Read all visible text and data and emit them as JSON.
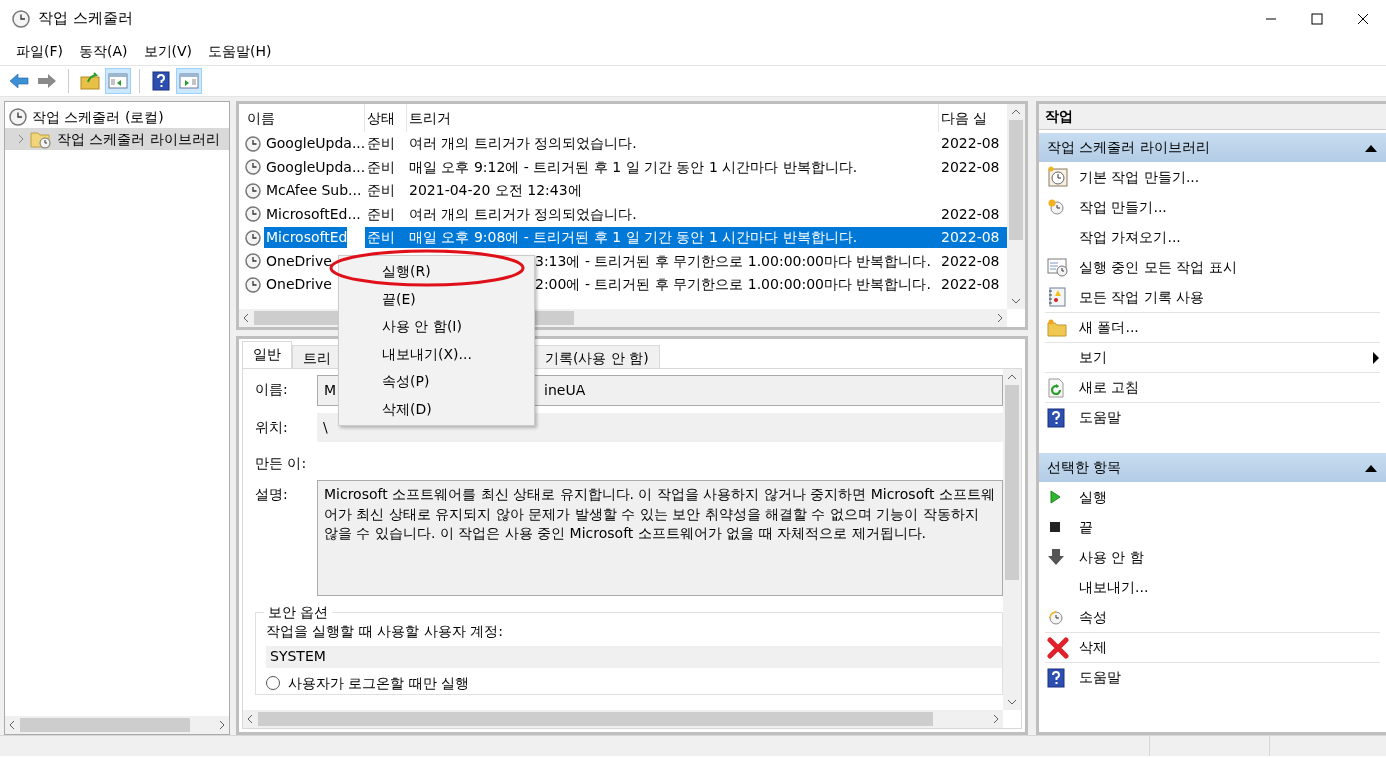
{
  "window": {
    "title": "작업 스케줄러"
  },
  "menu_bar": [
    "파일(F)",
    "동작(A)",
    "보기(V)",
    "도움말(H)"
  ],
  "toolbar": [
    {
      "pressed": false,
      "disabled": false
    },
    {
      "pressed": false,
      "disabled": true
    },
    {
      "pressed": false,
      "disabled": false
    },
    {
      "pressed": true,
      "disabled": false
    },
    {
      "pressed": false,
      "disabled": false
    },
    {
      "pressed": true,
      "disabled": false
    }
  ],
  "tree": [
    {
      "label": "작업 스케줄러 (로컬)",
      "selected": false,
      "children": [
        {
          "label": "작업 스케줄러 라이브러리",
          "selected": true,
          "expanded": false
        }
      ]
    }
  ],
  "table": {
    "columns": [
      "이름",
      "상태",
      "트리거",
      "다음 실"
    ],
    "rows": [
      {
        "name": "GoogleUpda...",
        "status": "준비",
        "trigger": "여러 개의 트리거가 정의되었습니다.",
        "next": "2022-08",
        "selected": false,
        "covered": false
      },
      {
        "name": "GoogleUpda...",
        "status": "준비",
        "trigger": "매일 오후 9:12에 - 트리거된 후 1 일 기간 동안 1 시간마다 반복합니다.",
        "next": "2022-08",
        "selected": false,
        "covered": false
      },
      {
        "name": "McAfee Sub...",
        "status": "준비",
        "trigger": "2021-04-20 오전 12:43에",
        "selected": false,
        "covered": false
      },
      {
        "name": "MicrosoftEd...",
        "status": "준비",
        "trigger": "여러 개의 트리거가 정의되었습니다.",
        "next": "2022-08",
        "selected": false,
        "covered": false
      },
      {
        "name": "MicrosoftEd",
        "status": "준비",
        "trigger": "매일 오후 9:08에 - 트리거된 후 1 일 기간 동안 1 시간마다 반복합니다.",
        "next": "2022-08",
        "selected": true,
        "covered": false
      },
      {
        "name": "OneDrive",
        "trigger": "3:13에 - 트리거된 후 무기한으로 1.00:00:00마다 반복합니다.",
        "next": "2022-08",
        "selected": false,
        "covered": true
      },
      {
        "name": "OneDrive",
        "trigger": "2:00에 - 트리거된 후 무기한으로 1.00:00:00마다 반복합니다.",
        "next": "2022-08",
        "selected": false,
        "covered": true
      }
    ]
  },
  "detail_tabs": [
    {
      "label": "일반",
      "selected": true
    },
    {
      "label": "트리",
      "selected": false
    },
    {
      "label": "기록(사용 안 함)",
      "selected": false
    }
  ],
  "general": {
    "name_label": "이름:",
    "name_value_parts": [
      "M",
      "ineUA"
    ],
    "location_label": "위치:",
    "location_value": "\\",
    "author_label": "만든 이:",
    "description_label": "설명:",
    "description": "Microsoft 소프트웨어를 최신 상태로 유지합니다. 이 작업을 사용하지 않거나 중지하면 Microsoft 소프트웨어가 최신 상태로 유지되지 않아 문제가 발생할 수 있는 보안 취약성을 해결할 수 없으며 기능이 작동하지 않을 수 있습니다. 이 작업은 사용 중인 Microsoft 소프트웨어가 없을 때 자체적으로 제거됩니다.",
    "security_title": "보안 옵션",
    "account_label": "작업을 실행할 때 사용할 사용자 계정:",
    "account_value": "SYSTEM",
    "radio": {
      "label": "사용자가 로그온할 때만 실행",
      "selected": false
    }
  },
  "context_menu": [
    "실행(R)",
    "끝(E)",
    "사용 안 함(I)",
    "내보내기(X)...",
    "속성(P)",
    "삭제(D)"
  ],
  "actions": {
    "title": "작업",
    "sections": [
      {
        "title": "작업 스케줄러 라이브러리",
        "expanded": true,
        "items": [
          {
            "label": "기본 작업 만들기...",
            "separator_before": false,
            "submenu": false
          },
          {
            "label": "작업 만들기...",
            "separator_before": false,
            "submenu": false
          },
          {
            "label": "작업 가져오기...",
            "separator_before": false,
            "submenu": false
          },
          {
            "label": "실행 중인 모든 작업 표시",
            "separator_before": false,
            "submenu": false
          },
          {
            "label": "모든 작업 기록 사용",
            "separator_before": false,
            "submenu": false
          },
          {
            "label": "새 폴더...",
            "separator_before": true,
            "submenu": false
          },
          {
            "label": "보기",
            "separator_before": true,
            "submenu": true
          },
          {
            "label": "새로 고침",
            "separator_before": true,
            "submenu": false
          },
          {
            "label": "도움말",
            "separator_before": true,
            "submenu": false
          }
        ]
      },
      {
        "title": "선택한 항목",
        "expanded": true,
        "items": [
          {
            "label": "실행",
            "separator_before": false,
            "submenu": false
          },
          {
            "label": "끝",
            "separator_before": false,
            "submenu": false
          },
          {
            "label": "사용 안 함",
            "separator_before": false,
            "submenu": false
          },
          {
            "label": "내보내기...",
            "separator_before": false,
            "submenu": false
          },
          {
            "label": "속성",
            "separator_before": false,
            "submenu": false
          },
          {
            "label": "삭제",
            "separator_before": true,
            "submenu": false
          },
          {
            "label": "도움말",
            "separator_before": true,
            "submenu": false
          }
        ]
      }
    ]
  }
}
